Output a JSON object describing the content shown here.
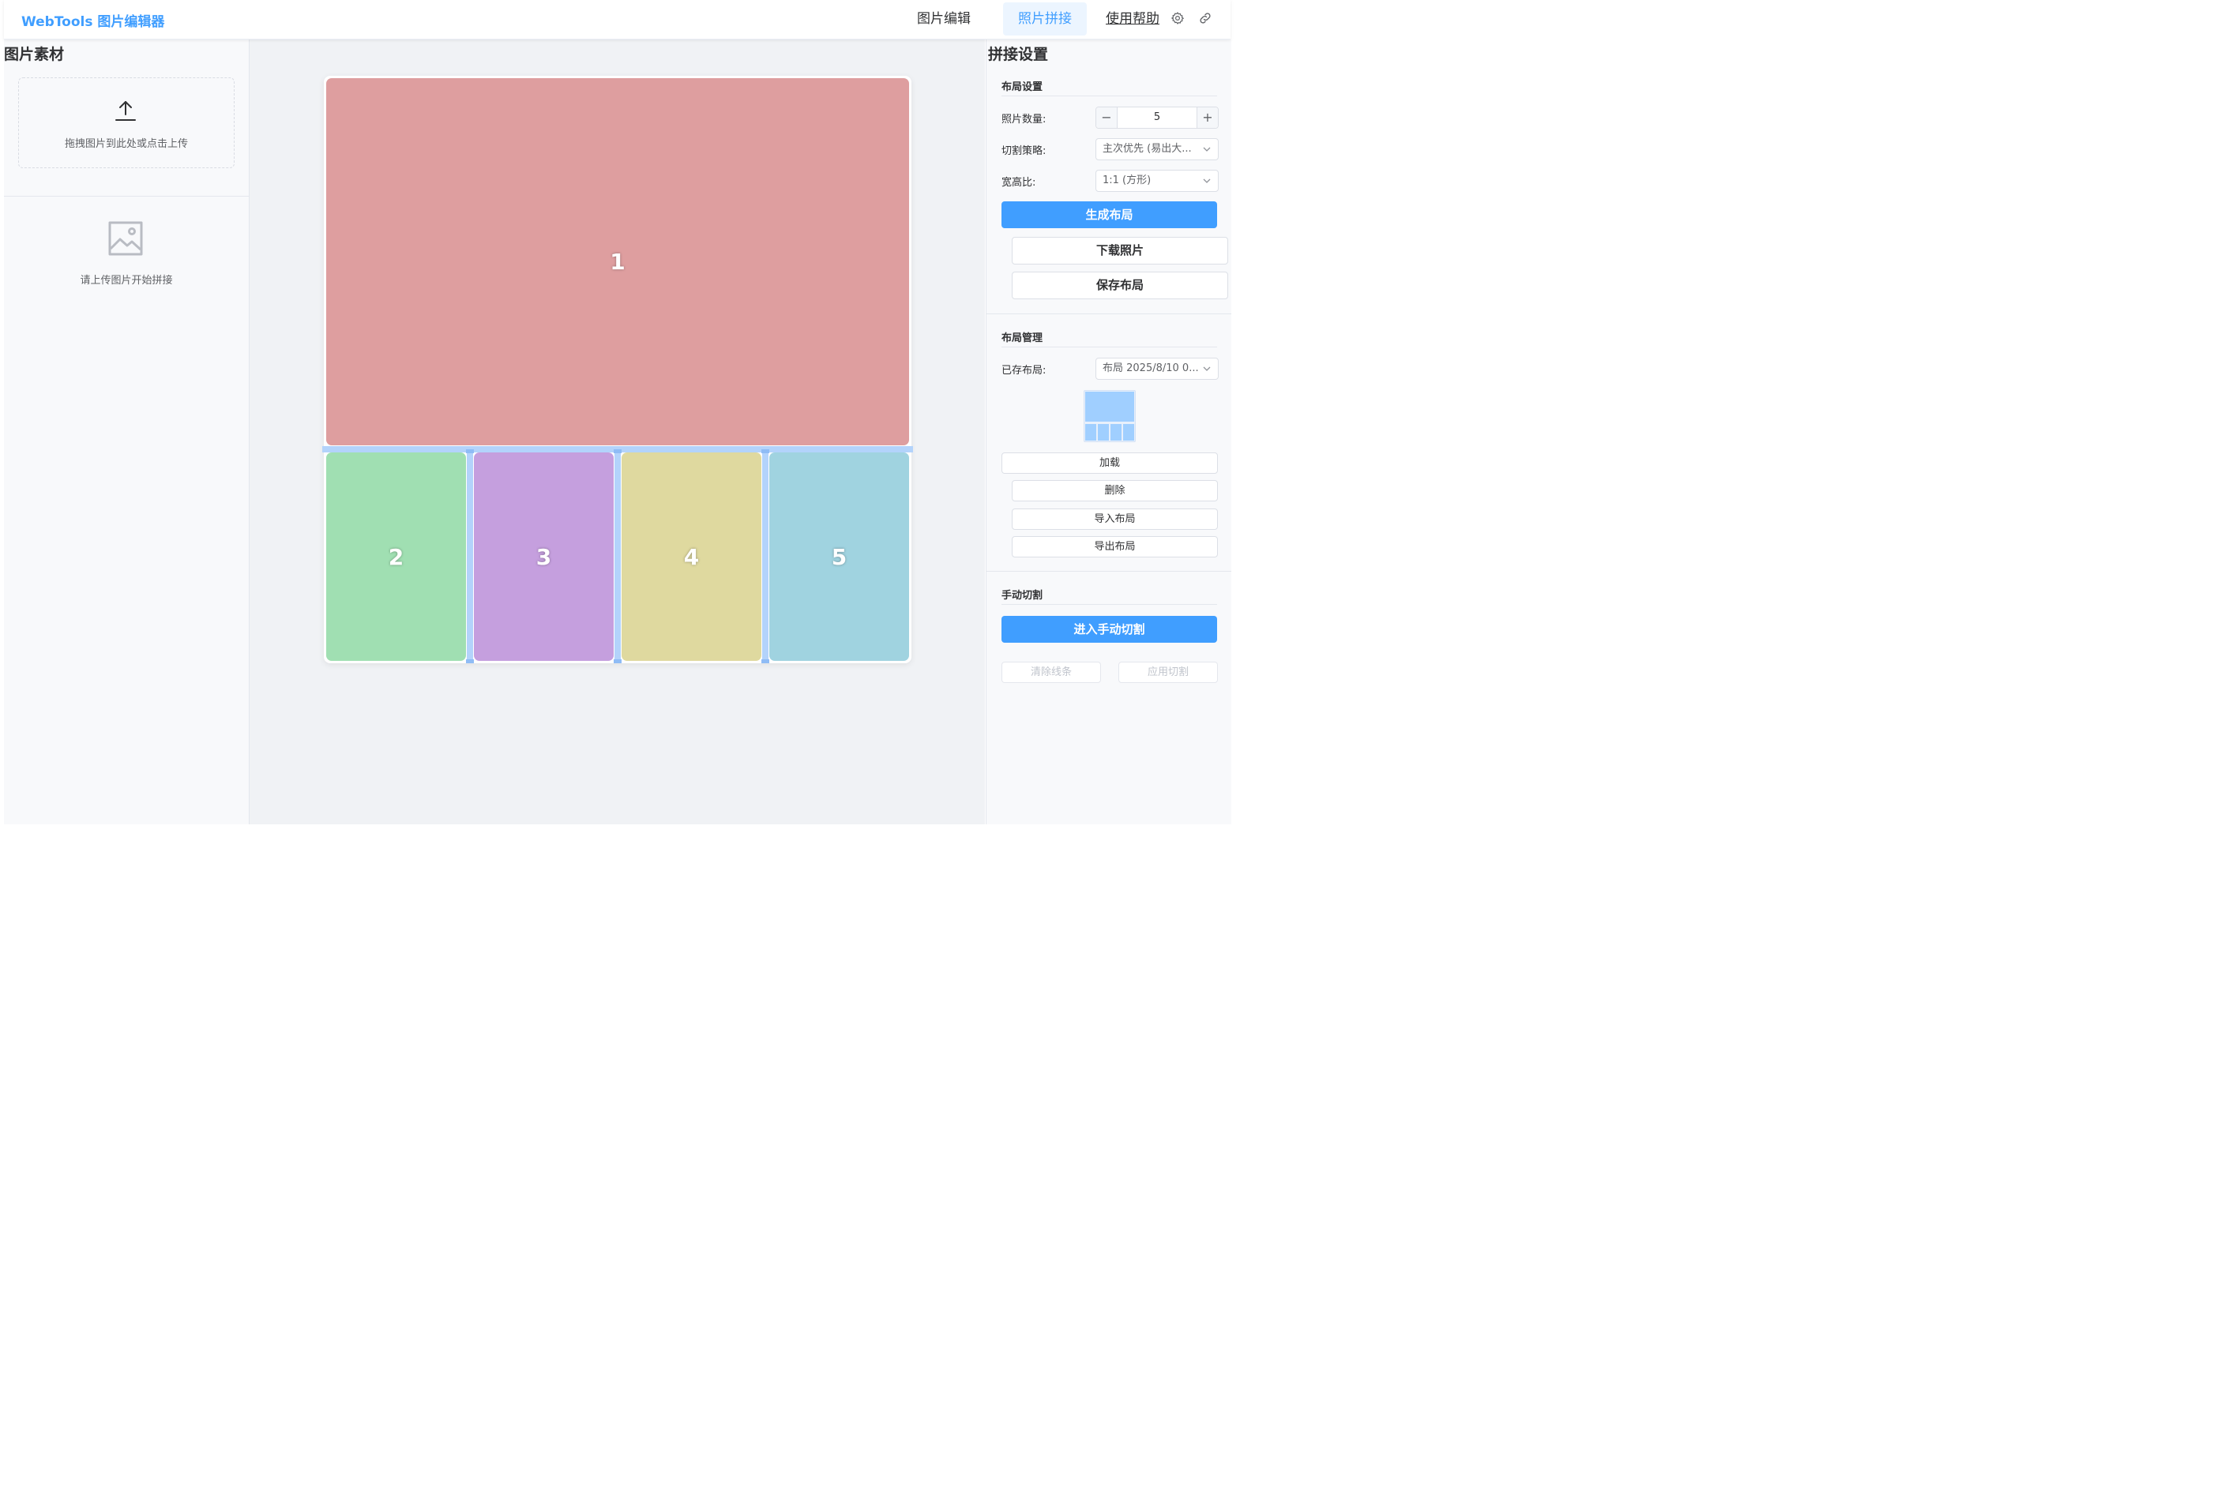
{
  "header": {
    "brand": "WebTools 图片编辑器",
    "nav": {
      "edit": "图片编辑",
      "collage": "照片拼接",
      "help": "使用帮助"
    },
    "icons": [
      "gear-icon",
      "link-icon"
    ]
  },
  "left_panel": {
    "title": "图片素材",
    "upload_hint": "拖拽图片到此处或点击上传",
    "empty_hint": "请上传图片开始拼接"
  },
  "canvas": {
    "cells": [
      {
        "label": "1",
        "color": "#de9e9f"
      },
      {
        "label": "2",
        "color": "#a0dfb2"
      },
      {
        "label": "3",
        "color": "#c59fde"
      },
      {
        "label": "4",
        "color": "#dfd99f"
      },
      {
        "label": "5",
        "color": "#a0d3e0"
      }
    ],
    "divider_color": "#b3d3fb"
  },
  "right_panel": {
    "title": "拼接设置",
    "layout_settings": {
      "title": "布局设置",
      "count_label": "照片数量:",
      "count_value": "5",
      "strategy_label": "切割策略:",
      "strategy_value": "主次优先 (易出大...",
      "ratio_label": "宽高比:",
      "ratio_value": "1:1 (方形)",
      "generate": "生成布局",
      "download": "下载照片",
      "save": "保存布局"
    },
    "layout_management": {
      "title": "布局管理",
      "saved_label": "已存布局:",
      "saved_value": "布局 2025/8/10 0...",
      "load": "加载",
      "delete": "删除",
      "import": "导入布局",
      "export": "导出布局"
    },
    "manual_cut": {
      "title": "手动切割",
      "enter": "进入手动切割",
      "clear": "清除线条",
      "apply": "应用切割"
    }
  },
  "colors": {
    "accent": "#409eff",
    "accent_light": "#ecf5ff"
  }
}
